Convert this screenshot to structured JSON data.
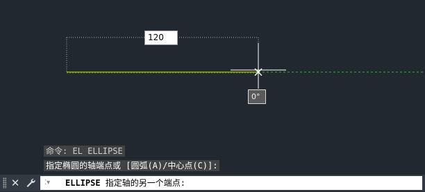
{
  "drawing": {
    "dimension_value": "120",
    "angle_value": "0°",
    "background_color": "#212830",
    "polar_tracking_color": "#2db82d",
    "ellipse_preview_color": "#c8b400"
  },
  "command_history": {
    "line1": "命令: EL ELLIPSE",
    "line2": "指定椭圆的轴端点或 [圆弧(A)/中心点(C)]:"
  },
  "command_line": {
    "command_name": "ELLIPSE",
    "prompt": " 指定轴的另一个端点:",
    "close_icon": "close-icon",
    "customize_icon": "wrench-icon",
    "prompt_icon": "command-prompt-icon"
  }
}
